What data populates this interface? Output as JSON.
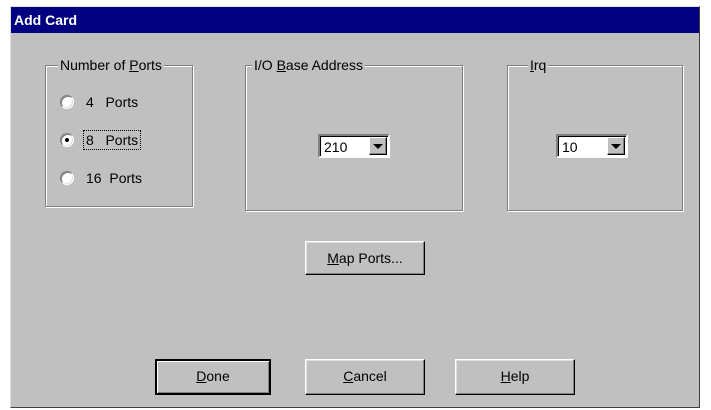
{
  "dialog": {
    "title": "Add Card"
  },
  "ports_group": {
    "legend_prefix": "Number of ",
    "legend_accel": "P",
    "legend_suffix": "orts",
    "options": [
      {
        "label": "4   Ports",
        "checked": false
      },
      {
        "label": "8   Ports",
        "checked": true
      },
      {
        "label": "16  Ports",
        "checked": false
      }
    ]
  },
  "io_group": {
    "legend_prefix": "I/O ",
    "legend_accel": "B",
    "legend_suffix": "ase Address",
    "selected": "210"
  },
  "irq_group": {
    "legend_accel": "I",
    "legend_suffix": "rq",
    "selected": "10"
  },
  "buttons": {
    "map_ports": {
      "accel": "M",
      "rest": "ap Ports..."
    },
    "done": {
      "accel": "D",
      "rest": "one"
    },
    "cancel": {
      "accel": "C",
      "rest": "ancel"
    },
    "help": {
      "accel": "H",
      "rest": "elp"
    }
  }
}
